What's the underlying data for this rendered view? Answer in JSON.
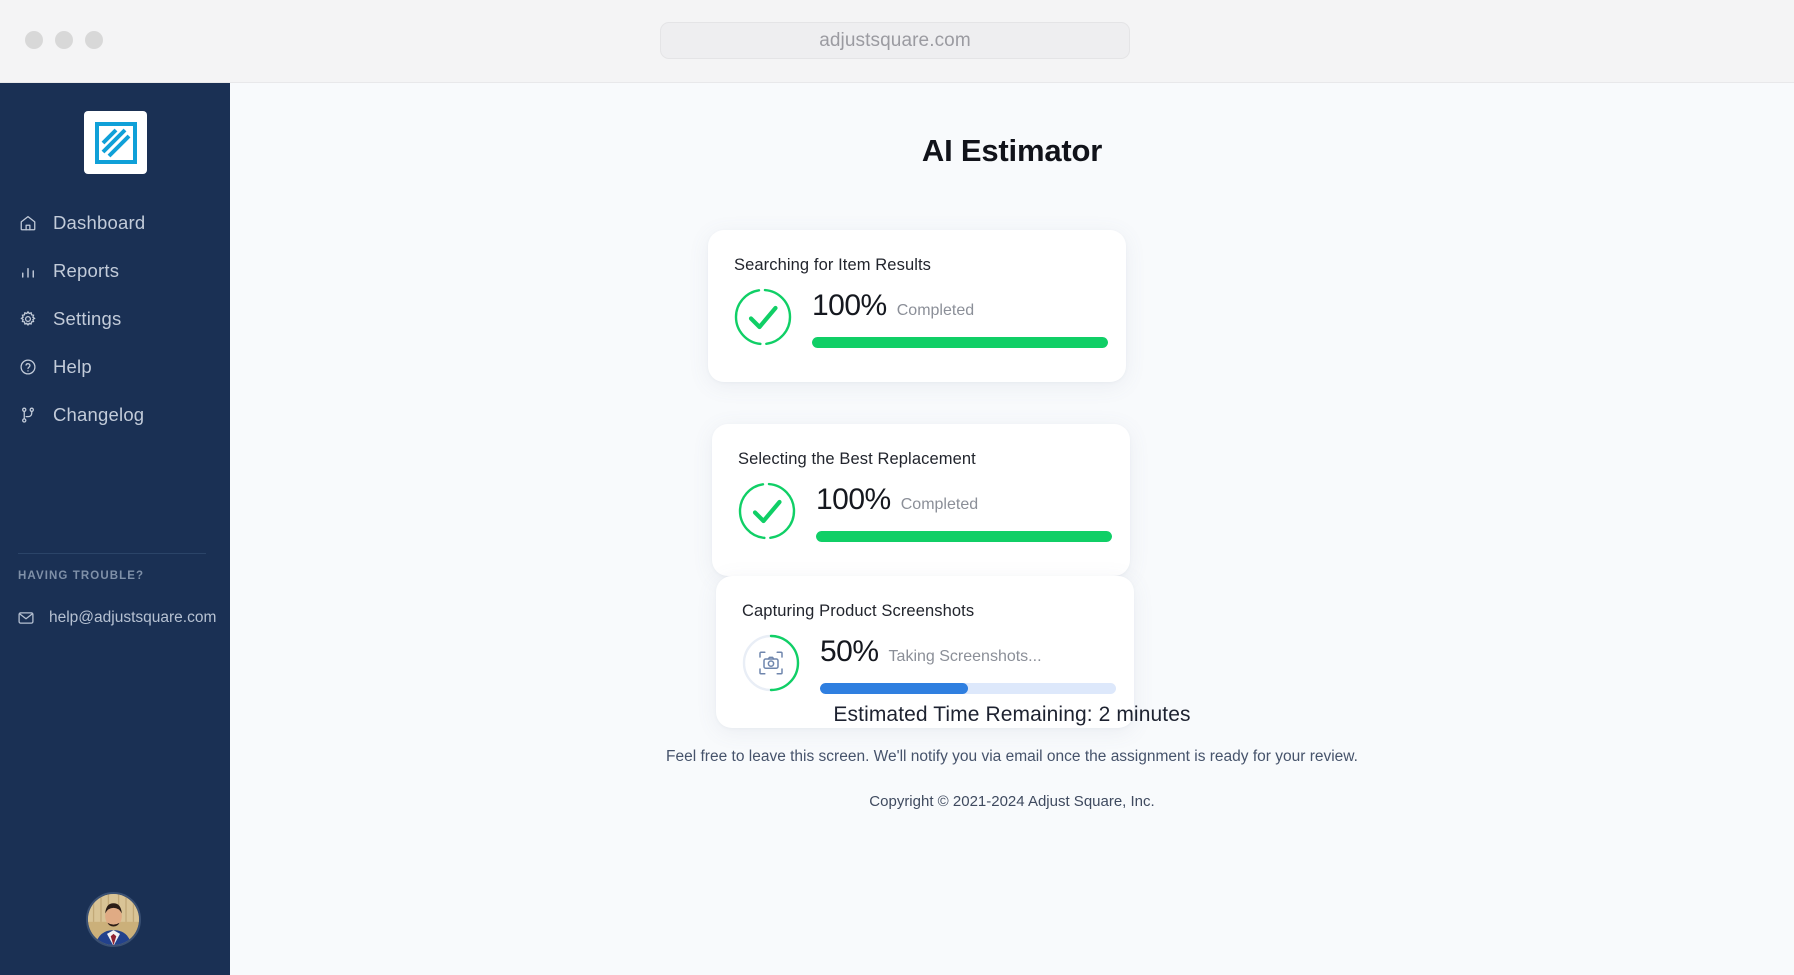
{
  "browser": {
    "url": "adjustsquare.com",
    "traffic_lights": [
      "close-dot",
      "minimize-dot",
      "maximize-dot"
    ]
  },
  "sidebar": {
    "logo_name": "adjust-square-logo",
    "items": [
      {
        "label": "Dashboard",
        "icon": "home-icon"
      },
      {
        "label": "Reports",
        "icon": "bar-chart-icon"
      },
      {
        "label": "Settings",
        "icon": "gear-icon"
      },
      {
        "label": "Help",
        "icon": "question-circle-icon"
      },
      {
        "label": "Changelog",
        "icon": "git-branch-icon"
      }
    ],
    "section_title": "HAVING TROUBLE?",
    "contact": {
      "label": "help@adjustsquare.com",
      "icon": "mail-icon"
    },
    "avatar_name": "user-avatar",
    "bg_color": "#1a3054"
  },
  "main": {
    "title": "AI Estimator",
    "cards": [
      {
        "title": "Searching for Item Results",
        "percent": "100%",
        "percent_value": 100,
        "state": "Completed",
        "icon": "check-circle-icon",
        "bar_color": "#10cf66",
        "ring_color": "#10cf66"
      },
      {
        "title": "Selecting the Best Replacement",
        "percent": "100%",
        "percent_value": 100,
        "state": "Completed",
        "icon": "check-circle-icon",
        "bar_color": "#10cf66",
        "ring_color": "#10cf66"
      },
      {
        "title": "Capturing Product Screenshots",
        "percent": "50%",
        "percent_value": 50,
        "state": "Taking Screenshots...",
        "icon": "camera-icon",
        "bar_color": "#2f7fe0",
        "ring_color": "#10cf66"
      }
    ],
    "eta": "Estimated Time Remaining: 2 minutes",
    "note": "Feel free to leave this screen. We'll notify you via email once the assignment is ready for your review.",
    "copyright": "Copyright © 2021-2024 Adjust Square, Inc."
  }
}
